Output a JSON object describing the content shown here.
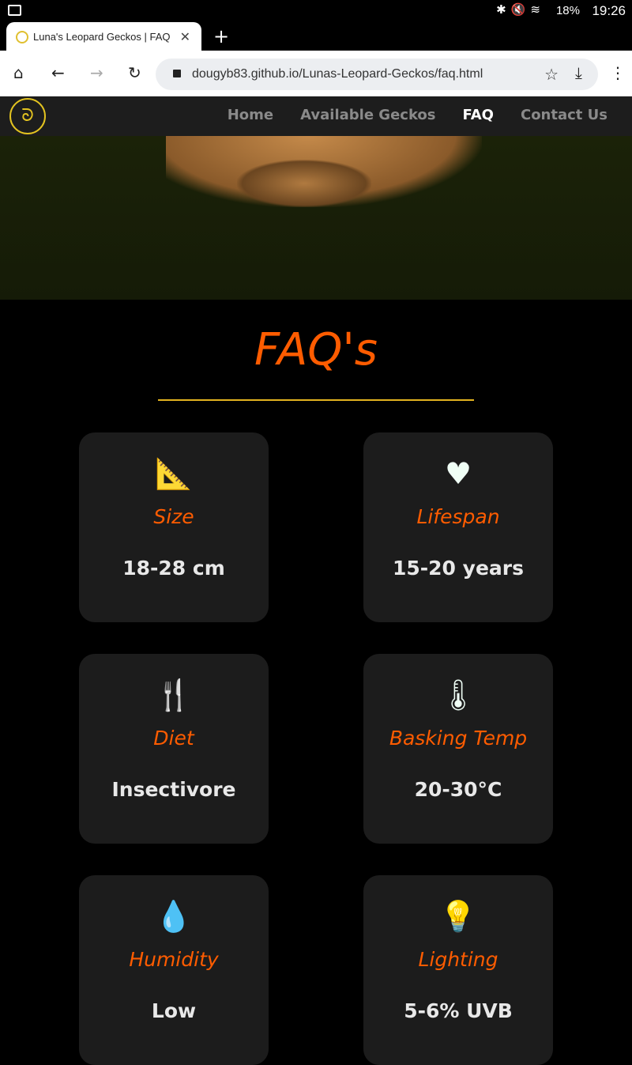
{
  "status": {
    "battery": "18%",
    "time": "19:26"
  },
  "browser": {
    "tab_title": "Luna's Leopard Geckos | FAQ",
    "url": "dougyb83.github.io/Lunas-Leopard-Geckos/faq.html"
  },
  "nav": {
    "items": [
      {
        "label": "Home"
      },
      {
        "label": "Available Geckos"
      },
      {
        "label": "FAQ"
      },
      {
        "label": "Contact Us"
      }
    ]
  },
  "page": {
    "title": "FAQ's"
  },
  "cards": [
    {
      "icon": "ruler-icon",
      "title": "Size",
      "value": "18-28 cm"
    },
    {
      "icon": "heartbeat-icon",
      "title": "Lifespan",
      "value": "15-20 years"
    },
    {
      "icon": "utensils-icon",
      "title": "Diet",
      "value": "Insectivore"
    },
    {
      "icon": "thermometer-icon",
      "title": "Basking Temp",
      "value": "20-30°C"
    },
    {
      "icon": "droplet-icon",
      "title": "Humidity",
      "value": "Low"
    },
    {
      "icon": "lightbulb-icon",
      "title": "Lighting",
      "value": "5-6% UVB"
    }
  ],
  "colors": {
    "accent": "#ff5c00",
    "gold": "#e3b320",
    "card": "#1c1c1c"
  }
}
